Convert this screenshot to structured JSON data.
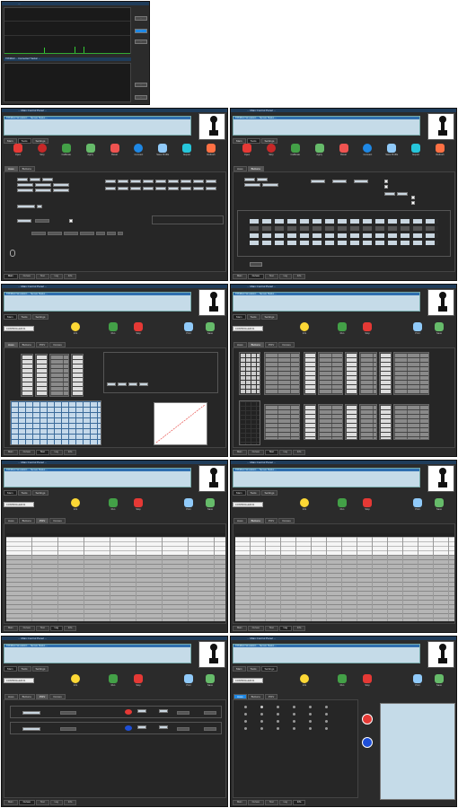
{
  "small_window": {
    "title": "...",
    "status_title": "TPFMG0 ... Connected Tracker ...",
    "side_buttons": [
      "..",
      "..",
      "..",
      "..",
      ".."
    ]
  },
  "common": {
    "title": "... Main Control Panel ...",
    "status_head": "TPFMG0 Simulation ... Sensor Status ...",
    "menu": [
      "Main",
      "Tools",
      "Settings"
    ],
    "device": "CONTROLLER 01"
  },
  "windows": [
    {
      "toolbar": [
        "Open",
        "Stop",
        "Calibrate",
        "Apply",
        "Reset",
        "Connect",
        "Save Profile",
        "Export",
        "Refresh"
      ],
      "tabs": [
        "Axes",
        "Buttons"
      ],
      "bottom_tabs": [
        "Main",
        "Curves",
        "Test",
        "Log",
        "Info"
      ],
      "active_bottom": 0
    },
    {
      "toolbar": [
        "Open",
        "Stop",
        "Calibrate",
        "Apply",
        "Reset",
        "Connect",
        "Save Profile",
        "Export",
        "Refresh"
      ],
      "tabs": [
        "Axes",
        "Buttons"
      ],
      "bottom_tabs": [
        "Main",
        "Curves",
        "Test",
        "Log",
        "Info"
      ],
      "active_bottom": 1
    },
    {
      "toolbar": [
        "Info",
        "Run",
        "Stop",
        "Print",
        "Save"
      ],
      "tabs": [
        "Axes",
        "Buttons",
        "POV",
        "Curves"
      ],
      "bottom_tabs": [
        "Main",
        "Curves",
        "Test",
        "Log",
        "Info"
      ],
      "active_bottom": 2
    },
    {
      "toolbar": [
        "Info",
        "Run",
        "Stop",
        "Print",
        "Save"
      ],
      "tabs": [
        "Axes",
        "Buttons",
        "POV",
        "Curves"
      ],
      "bottom_tabs": [
        "Main",
        "Curves",
        "Test",
        "Log",
        "Info"
      ],
      "active_bottom": 2
    },
    {
      "toolbar": [
        "Info",
        "Run",
        "Stop",
        "Print",
        "Save"
      ],
      "tabs": [
        "Axes",
        "Buttons",
        "POV",
        "Curves"
      ],
      "bottom_tabs": [
        "Main",
        "Curves",
        "Test",
        "Log",
        "Info"
      ],
      "active_bottom": 3
    },
    {
      "toolbar": [
        "Info",
        "Run",
        "Stop",
        "Print",
        "Save"
      ],
      "tabs": [
        "Axes",
        "Buttons",
        "POV",
        "Curves"
      ],
      "bottom_tabs": [
        "Main",
        "Curves",
        "Test",
        "Log",
        "Info"
      ],
      "active_bottom": 3
    },
    {
      "toolbar": [
        "Info",
        "Run",
        "Stop",
        "Print",
        "Save"
      ],
      "tabs": [
        "Axes",
        "Buttons",
        "POV",
        "Curves"
      ],
      "bottom_tabs": [
        "Main",
        "Curves",
        "Test",
        "Log",
        "Info"
      ],
      "active_bottom": 1
    },
    {
      "toolbar": [
        "Info",
        "Run",
        "Stop",
        "Print",
        "Save"
      ],
      "tabs": [
        "Axes",
        "Buttons",
        "POV"
      ],
      "bottom_tabs": [
        "Main",
        "Curves",
        "Test",
        "Log",
        "Info"
      ],
      "active_bottom": 4
    }
  ],
  "colors": {
    "window_bg": "#2b2b2b",
    "status_bg": "#c5dbe8",
    "accent": "#1e88e5",
    "red_button": "#e53935",
    "blue_button": "#1e4fd8"
  }
}
